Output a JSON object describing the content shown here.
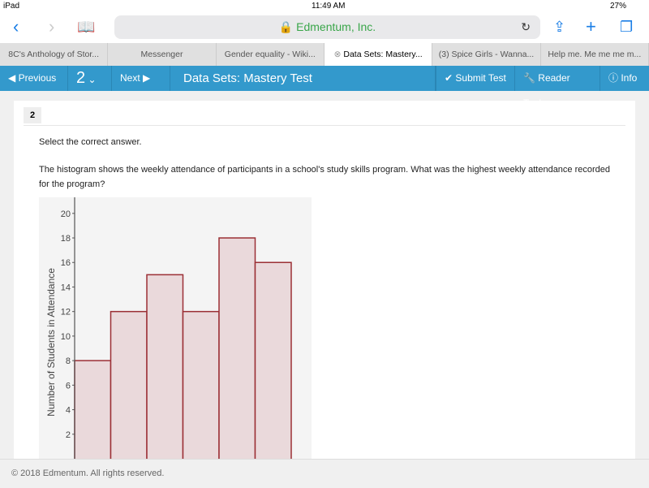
{
  "status": {
    "device": "iPad",
    "time": "11:49 AM",
    "battery": "27%"
  },
  "browser": {
    "url_label": "Edmentum, Inc.",
    "tabs": [
      {
        "label": "8C's Anthology of Stor..."
      },
      {
        "label": "Messenger"
      },
      {
        "label": "Gender equality - Wiki..."
      },
      {
        "label": "Data Sets: Mastery...",
        "active": true
      },
      {
        "label": "(3) Spice Girls - Wanna..."
      },
      {
        "label": "Help me. Me me me m..."
      }
    ]
  },
  "nav": {
    "previous": "Previous",
    "question_number": "2",
    "next": "Next",
    "title": "Data Sets: Mastery Test",
    "submit": "Submit Test",
    "reader_tools": "Reader Tools",
    "info": "Info",
    "color": "#3399cc"
  },
  "question": {
    "number": "2",
    "instruction": "Select the correct answer.",
    "text": "The histogram shows the weekly attendance of participants in a school's study skills program. What was the highest weekly attendance recorded for the program?"
  },
  "chart_data": {
    "type": "bar",
    "ylabel": "Number of Students in Attendance",
    "values": [
      8,
      12,
      15,
      12,
      18,
      16
    ],
    "yticks": [
      2,
      4,
      6,
      8,
      10,
      12,
      14,
      16,
      18,
      20
    ],
    "ylim": [
      0,
      21
    ],
    "bar_fill": "#ead9db",
    "bar_stroke": "#9b2f35",
    "grid": false
  },
  "footer": {
    "copyright": "© 2018 Edmentum. All rights reserved."
  }
}
